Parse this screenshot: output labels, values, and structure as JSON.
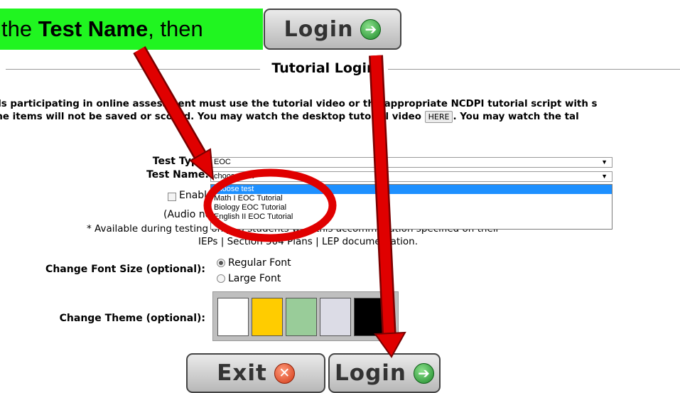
{
  "callout": {
    "pre": "the ",
    "bold": "Test Name",
    "post": ", then"
  },
  "buttons": {
    "login_top": "Login",
    "exit": "Exit",
    "login_bottom": "Login"
  },
  "legend": {
    "title": "Tutorial Login"
  },
  "info": {
    "line1": "ols participating in online assessment must use the tutorial video or the appropriate NCDPI tutorial script with s",
    "line2_a": " the items will not be saved or scored. You may watch the desktop tutorial video ",
    "here": "HERE",
    "line2_b": ".  You may watch the tal"
  },
  "form": {
    "test_type_label": "Test Type:",
    "test_type_value": "EOC",
    "test_name_label": "Test Name:",
    "test_name_value": "choose test",
    "options": [
      "choose test",
      "Math I EOC Tutorial",
      "Biology EOC Tutorial",
      "English II EOC Tutorial"
    ],
    "enable_label": "Enable",
    "audio_note": "(Audio not",
    "available_note_a": "* Available during testing only to students with this accommodation specified on their",
    "available_note_b": "IEPs | Section 504 Plans | LEP documentation.",
    "font_size_label": "Change Font Size (optional):",
    "font_regular": "Regular Font",
    "font_large": "Large Font",
    "theme_label": "Change Theme (optional):",
    "theme_colors": [
      "#ffffff",
      "#ffcc00",
      "#99cc99",
      "#dcdce6",
      "#000000"
    ]
  },
  "annotation_colors": {
    "highlight": "#20f520",
    "arrow": "#e00000"
  }
}
